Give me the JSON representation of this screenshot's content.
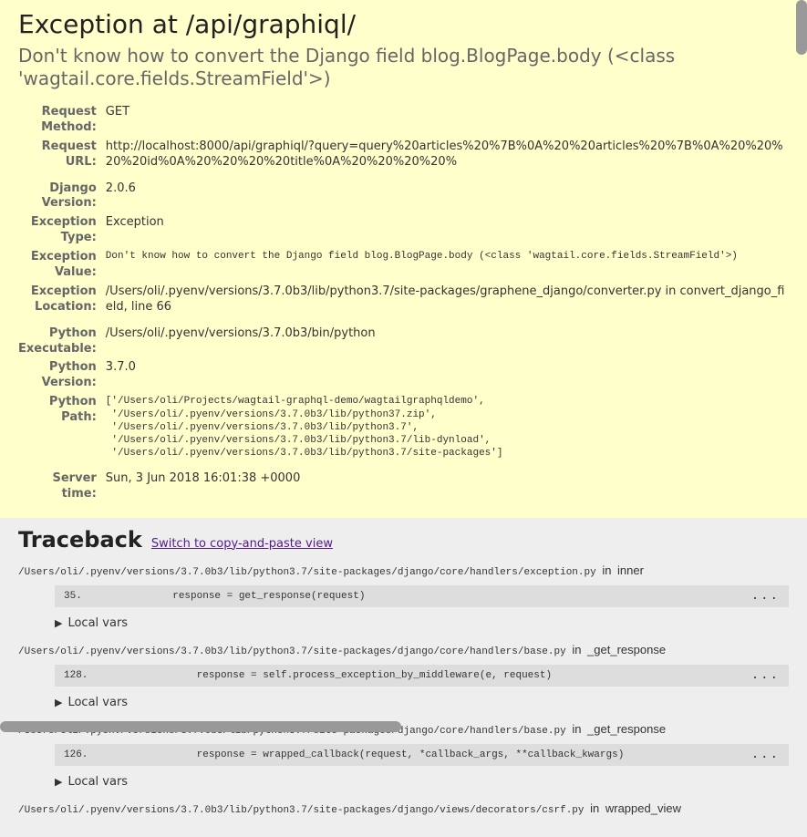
{
  "summary": {
    "title": "Exception at /api/graphiql/",
    "error": "Don't know how to convert the Django field blog.BlogPage.body (<class 'wagtail.core.fields.StreamField'>)",
    "rows": {
      "request_method": {
        "label": "Request Method:",
        "value": "GET"
      },
      "request_url": {
        "label": "Request URL:",
        "value": "http://localhost:8000/api/graphiql/?query=query%20articles%20%7B%0A%20%20articles%20%7B%0A%20%20%20%20id%0A%20%20%20%20title%0A%20%20%20%20%"
      },
      "django_version": {
        "label": "Django Version:",
        "value": "2.0.6"
      },
      "exception_type": {
        "label": "Exception Type:",
        "value": "Exception"
      },
      "exception_value": {
        "label": "Exception Value:",
        "value": "Don't know how to convert the Django field blog.BlogPage.body (<class 'wagtail.core.fields.StreamField'>)"
      },
      "exception_location": {
        "label": "Exception Location:",
        "value": "/Users/oli/.pyenv/versions/3.7.0b3/lib/python3.7/site-packages/graphene_django/converter.py in convert_django_field, line 66"
      },
      "python_executable": {
        "label": "Python Executable:",
        "value": "/Users/oli/.pyenv/versions/3.7.0b3/bin/python"
      },
      "python_version": {
        "label": "Python Version:",
        "value": "3.7.0"
      },
      "python_path": {
        "label": "Python Path:",
        "value": "['/Users/oli/Projects/wagtail-graphql-demo/wagtailgraphqldemo',\n '/Users/oli/.pyenv/versions/3.7.0b3/lib/python37.zip',\n '/Users/oli/.pyenv/versions/3.7.0b3/lib/python3.7',\n '/Users/oli/.pyenv/versions/3.7.0b3/lib/python3.7/lib-dynload',\n '/Users/oli/.pyenv/versions/3.7.0b3/lib/python3.7/site-packages']"
      },
      "server_time": {
        "label": "Server time:",
        "value": "Sun, 3 Jun 2018 16:01:38 +0000"
      }
    }
  },
  "traceback": {
    "heading": "Traceback",
    "switch_link": "Switch to copy-and-paste view",
    "local_vars_label": "Local vars",
    "in_word": "in",
    "dots": "...",
    "frames": [
      {
        "file": "/Users/oli/.pyenv/versions/3.7.0b3/lib/python3.7/site-packages/django/core/handlers/exception.py",
        "func": "inner",
        "lineno": "35.",
        "code": "            response = get_response(request)"
      },
      {
        "file": "/Users/oli/.pyenv/versions/3.7.0b3/lib/python3.7/site-packages/django/core/handlers/base.py",
        "func": "_get_response",
        "lineno": "128.",
        "code": "                response = self.process_exception_by_middleware(e, request)"
      },
      {
        "file": "/Users/oli/.pyenv/versions/3.7.0b3/lib/python3.7/site-packages/django/core/handlers/base.py",
        "func": "_get_response",
        "lineno": "126.",
        "code": "                response = wrapped_callback(request, *callback_args, **callback_kwargs)"
      },
      {
        "file": "/Users/oli/.pyenv/versions/3.7.0b3/lib/python3.7/site-packages/django/views/decorators/csrf.py",
        "func": "wrapped_view",
        "lineno": "",
        "code": ""
      }
    ]
  }
}
